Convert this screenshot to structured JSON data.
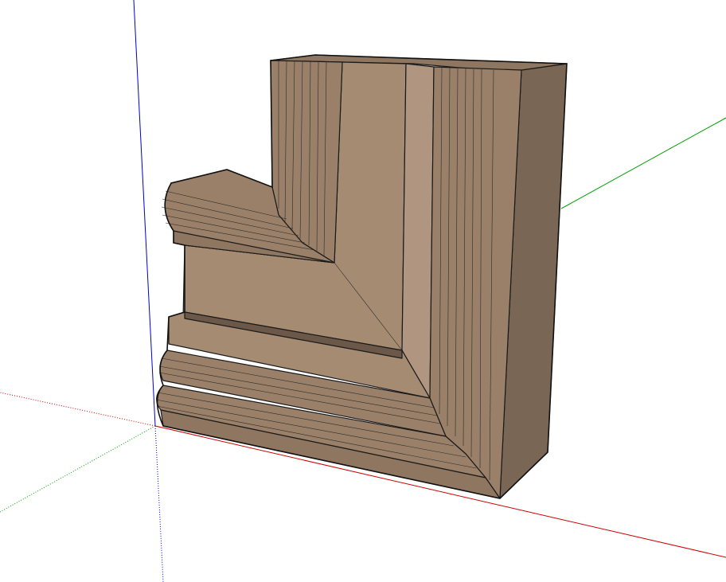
{
  "scene": {
    "axes": {
      "red_color": "#cc0000",
      "green_color": "#00a000",
      "blue_color": "#0000c8"
    },
    "material": {
      "front_color": "#a58b72",
      "top_color": "#8e7660",
      "side_color": "#7a6654",
      "shadow_color": "#6b5848"
    }
  }
}
